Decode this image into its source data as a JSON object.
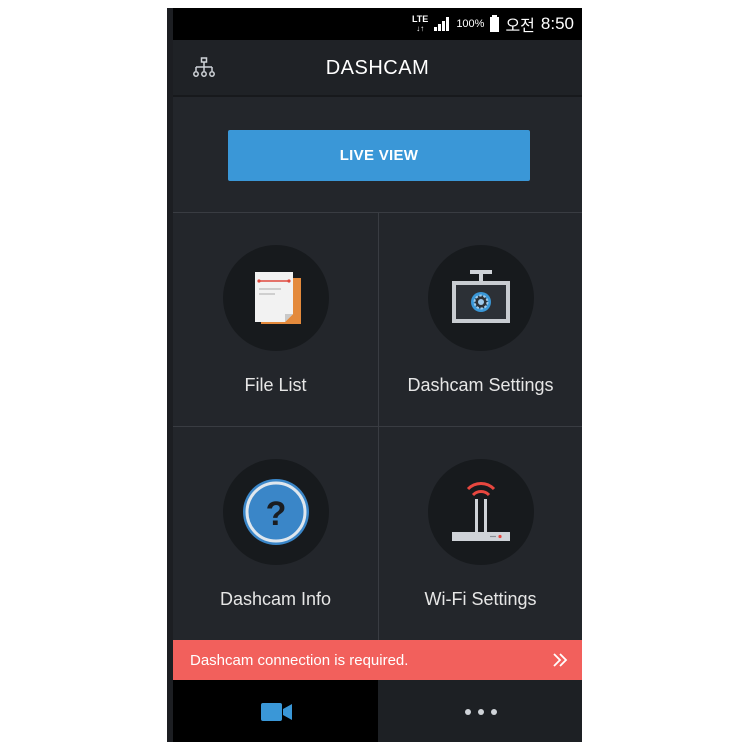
{
  "status_bar": {
    "network": "LTE",
    "battery_percent": "100%",
    "ampm": "오전",
    "time": "8:50"
  },
  "header": {
    "title": "DASHCAM",
    "left_icon": "network-tree-icon"
  },
  "live_view": {
    "label": "LIVE VIEW"
  },
  "tiles": [
    {
      "label": "File List",
      "icon": "file-list-icon"
    },
    {
      "label": "Dashcam Settings",
      "icon": "dashcam-settings-icon"
    },
    {
      "label": "Dashcam Info",
      "icon": "question-icon"
    },
    {
      "label": "Wi-Fi Settings",
      "icon": "wifi-router-icon"
    }
  ],
  "alert": {
    "message": "Dashcam connection is required.",
    "icon": "double-chevron-right-icon"
  },
  "bottom_nav": [
    {
      "icon": "video-camera-icon",
      "active": true
    },
    {
      "icon": "more-dots-icon",
      "active": false
    }
  ],
  "colors": {
    "accent_blue": "#3a97d7",
    "alert_red": "#f2605c",
    "background": "#23262b"
  }
}
